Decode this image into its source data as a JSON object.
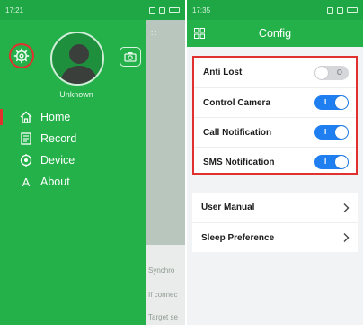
{
  "left_screen": {
    "status": {
      "time": "17:21"
    },
    "drawer": {
      "username": "Unknown",
      "menu": [
        {
          "label": "Home",
          "icon": "home-icon",
          "active": true
        },
        {
          "label": "Record",
          "icon": "record-icon",
          "active": false
        },
        {
          "label": "Device",
          "icon": "device-icon",
          "active": false
        },
        {
          "label": "About",
          "icon": "about-letter-icon",
          "active": false
        }
      ]
    },
    "background_text": [
      "Synchro",
      "If connec",
      "Target se"
    ]
  },
  "right_screen": {
    "status": {
      "time": "17:35"
    },
    "title": "Config",
    "toggles": [
      {
        "label": "Anti Lost",
        "state": "off",
        "mark": "O"
      },
      {
        "label": "Control Camera",
        "state": "on",
        "mark": "I"
      },
      {
        "label": "Call Notification",
        "state": "on",
        "mark": "I"
      },
      {
        "label": "SMS Notification",
        "state": "on",
        "mark": "I"
      }
    ],
    "links": [
      {
        "label": "User Manual"
      },
      {
        "label": "Sleep Preference"
      }
    ]
  },
  "colors": {
    "brand_green": "#25b14a",
    "highlight_red": "#e0312e",
    "toggle_on_blue": "#1f7ff0",
    "toggle_off_gray": "#d5d7da"
  }
}
